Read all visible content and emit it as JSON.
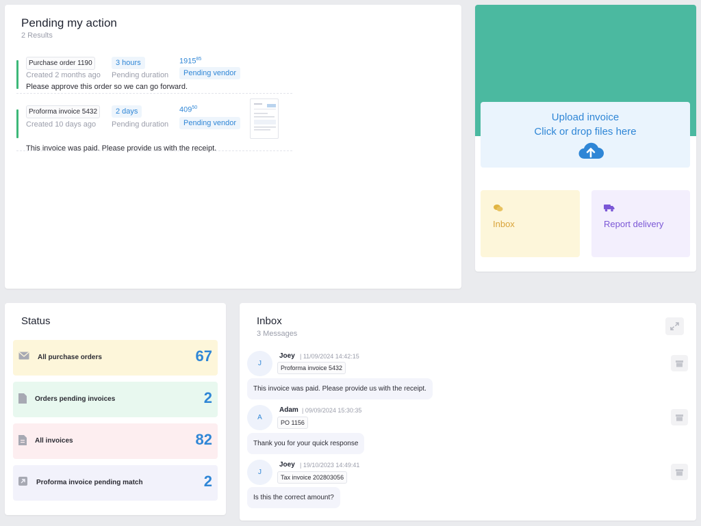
{
  "pending": {
    "title": "Pending my action",
    "subtitle": "2 Results",
    "items": [
      {
        "ref": "Purchase order 1190",
        "created": "Created 2 months ago",
        "duration": "3 hours",
        "duration_label": "Pending duration",
        "amount_main": "1915",
        "amount_cents": "85",
        "status": "Pending vendor",
        "message": "Please approve this order so we can go forward."
      },
      {
        "ref": "Proforma invoice 5432",
        "created": "Created 10 days ago",
        "duration": "2 days",
        "duration_label": "Pending duration",
        "amount_main": "409",
        "amount_cents": "50",
        "status": "Pending vendor",
        "message": "This invoice was paid. Please provide us with the receipt."
      }
    ]
  },
  "upload": {
    "line1": "Upload invoice",
    "line2": "Click or drop files here",
    "icon": "cloud-upload-icon"
  },
  "tiles": {
    "inbox": {
      "label": "Inbox",
      "icon": "chat-bubbles-icon",
      "color": "#d9a43a"
    },
    "report": {
      "label": "Report delivery",
      "icon": "truck-icon",
      "color": "#7b57d6"
    }
  },
  "status": {
    "title": "Status",
    "rows": [
      {
        "label": "All purchase orders",
        "value": "67",
        "icon": "envelope-icon",
        "bg": "#fdf6da"
      },
      {
        "label": "Orders pending invoices",
        "value": "2",
        "icon": "document-icon",
        "bg": "#e8f8ef"
      },
      {
        "label": "All invoices",
        "value": "82",
        "icon": "invoice-icon",
        "bg": "#fdeef0"
      },
      {
        "label": "Proforma invoice pending match",
        "value": "2",
        "icon": "arrow-box-icon",
        "bg": "#f2f2fb"
      }
    ]
  },
  "inbox": {
    "title": "Inbox",
    "subtitle": "3 Messages",
    "messages": [
      {
        "initial": "J",
        "sender": "Joey",
        "date": "| 11/09/2024 14:42:15",
        "ref": "Proforma invoice 5432",
        "text": "This invoice was paid. Please provide us with the receipt."
      },
      {
        "initial": "A",
        "sender": "Adam",
        "date": "| 09/09/2024 15:30:35",
        "ref": "PO 1156",
        "text": "Thank you for your quick response"
      },
      {
        "initial": "J",
        "sender": "Joey",
        "date": "| 19/10/2023 14:49:41",
        "ref": "Tax invoice 202803056",
        "text": "Is this the correct amount?"
      }
    ]
  },
  "colors": {
    "accent": "#2f86d6",
    "green": "#4bb9a0",
    "bar": "#3cb878"
  }
}
